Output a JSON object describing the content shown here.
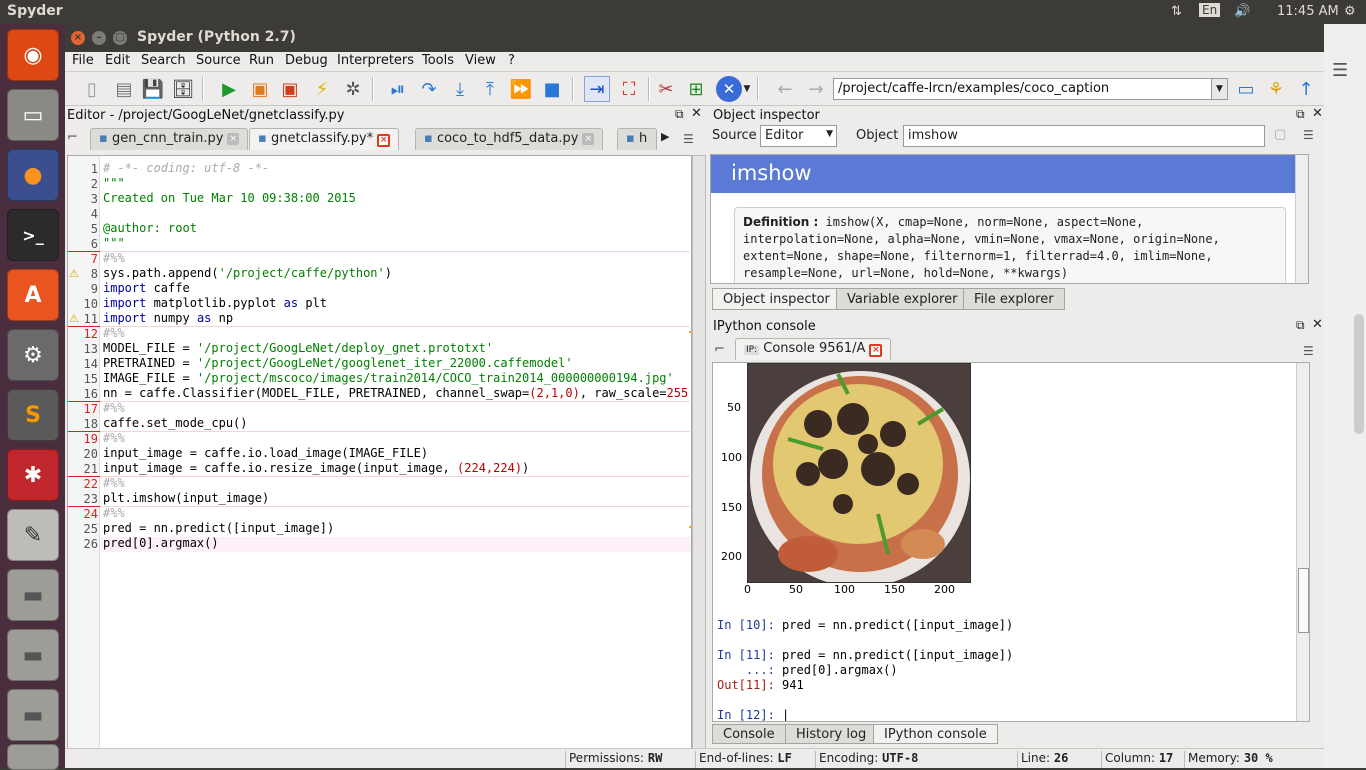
{
  "topbar": {
    "app_name": "Spyder",
    "lang": "En",
    "time": "11:45 AM"
  },
  "launcher": {
    "items": [
      "ubuntu-icon",
      "files-icon",
      "firefox-icon",
      "terminal-icon",
      "software-center-icon",
      "settings-icon",
      "sublime-icon",
      "network-icon",
      "text-editor-icon",
      "drive-icon",
      "drive-icon",
      "drive-icon",
      "trash-icon"
    ]
  },
  "window": {
    "title": "Spyder (Python 2.7)"
  },
  "menu": [
    "File",
    "Edit",
    "Search",
    "Source",
    "Run",
    "Debug",
    "Interpreters",
    "Tools",
    "View",
    "?"
  ],
  "toolbar": {
    "path": "/project/caffe-lrcn/examples/coco_caption"
  },
  "editor": {
    "title": "Editor - /project/GoogLeNet/gnetclassify.py",
    "tabs": [
      {
        "label": "gen_cnn_train.py"
      },
      {
        "label": "gnetclassify.py*"
      },
      {
        "label": "coco_to_hdf5_data.py"
      },
      {
        "label": "h"
      }
    ],
    "lines": [
      "# -*- coding: utf-8 -*-",
      "\"\"\"",
      "Created on Tue Mar 10 09:38:00 2015",
      "",
      "@author: root",
      "\"\"\"",
      "#%%",
      "sys.path.append('/project/caffe/python')",
      "import caffe",
      "import matplotlib.pyplot as plt",
      "import numpy as np",
      "#%%",
      "MODEL_FILE = '/project/GoogLeNet/deploy_gnet.prototxt'",
      "PRETRAINED = '/project/GoogLeNet/googlenet_iter_22000.caffemodel'",
      "IMAGE_FILE = '/project/mscoco/images/train2014/COCO_train2014_000000000194.jpg'",
      "nn = caffe.Classifier(MODEL_FILE, PRETRAINED, channel_swap=(2,1,0), raw_scale=255",
      "#%%",
      "caffe.set_mode_cpu()",
      "#%%",
      "input_image = caffe.io.load_image(IMAGE_FILE)",
      "input_image = caffe.io.resize_image(input_image, (224,224))",
      "#%%",
      "plt.imshow(input_image)",
      "#%%",
      "pred = nn.predict([input_image])",
      "pred[0].argmax()"
    ]
  },
  "inspector": {
    "title": "Object inspector",
    "source_label": "Source",
    "source_value": "Editor",
    "object_label": "Object",
    "object_value": "imshow",
    "doc_title": "imshow",
    "definition_label": "Definition :",
    "definition": "imshow(X, cmap=None, norm=None, aspect=None, interpolation=None, alpha=None, vmin=None, vmax=None, origin=None, extent=None, shape=None, filternorm=1, filterrad=4.0, imlim=None, resample=None, url=None, hold=None, **kwargs)",
    "tabs": [
      "Object inspector",
      "Variable explorer",
      "File explorer"
    ]
  },
  "console": {
    "title": "IPython console",
    "tab": "Console 9561/A",
    "y_ticks": [
      "50",
      "100",
      "150",
      "200"
    ],
    "x_ticks": [
      "0",
      "50",
      "100",
      "150",
      "200"
    ],
    "lines": [
      {
        "prompt": "In [10]:",
        "text": " pred = nn.predict([input_image])"
      },
      {
        "prompt": "In [11]:",
        "text": " pred = nn.predict([input_image])"
      },
      {
        "prompt": "    ...:",
        "text": " pred[0].argmax()"
      },
      {
        "prompt": "Out[11]:",
        "text": " 941"
      },
      {
        "prompt": "In [12]:",
        "text": " |"
      }
    ],
    "tabs": [
      "Console",
      "History log",
      "IPython console"
    ]
  },
  "status": {
    "permissions_label": "Permissions:",
    "permissions": "RW",
    "eol_label": "End-of-lines:",
    "eol": "LF",
    "encoding_label": "Encoding:",
    "encoding": "UTF-8",
    "line_label": "Line:",
    "line": "26",
    "column_label": "Column:",
    "column": "17",
    "memory_label": "Memory:",
    "memory": "30 %"
  }
}
